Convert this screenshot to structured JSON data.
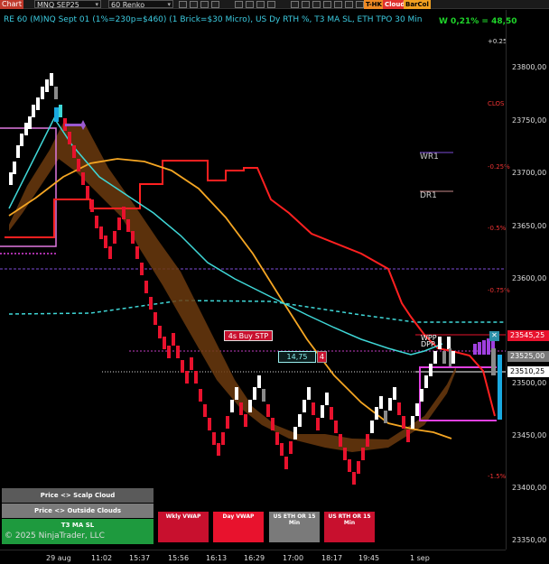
{
  "toolbar": {
    "chart_label": "Chart",
    "instrument": "MNQ SEP25",
    "period": "60 Renko",
    "tags": [
      {
        "label": "T-HK",
        "color": "#f08a24"
      },
      {
        "label": "Cloud",
        "color": "#e0312e"
      },
      {
        "label": "BarCol",
        "color": "#f0a020"
      }
    ]
  },
  "chart": {
    "title": "RE 60 (M)NQ Sept 01 (1%=230p=$460) (1 Brick=$30 Micro), US Dy RTH %, T3 MA SL, ETH TPO 30 Min",
    "pnl": "W 0,21% = 48,50"
  },
  "price_axis": {
    "ticks": [
      "23800,00",
      "23750,00",
      "23700,00",
      "23650,00",
      "23600,00",
      "23500,00",
      "23450,00",
      "23400,00",
      "23350,00"
    ],
    "tags": [
      {
        "label": "23545,25",
        "color": "#e8122d"
      },
      {
        "label": "23525,00",
        "color": "#7a7a7a"
      },
      {
        "label": "23510,25",
        "color": "#ffffff"
      }
    ]
  },
  "time_axis": {
    "ticks": [
      "29 aug",
      "11:02",
      "15:37",
      "15:56",
      "16:13",
      "16:29",
      "17:00",
      "18:17",
      "19:45",
      "1 sep"
    ]
  },
  "labels": {
    "pct_levels": [
      "+0.25",
      "CLOS",
      "-0.25%",
      "-0.5%",
      "-0.75%",
      "-1.5%"
    ],
    "wr1": "WR1",
    "dr1": "DR1",
    "wpp": "WPP",
    "dpp": "DPP",
    "buy_stop": "4s Buy STP",
    "order_price": "14,75",
    "order_qty": "4",
    "close_x": "✕"
  },
  "panel": {
    "rows": [
      "Price <> Scalp Cloud",
      "Price <> Outside Clouds",
      "T3 MA SL"
    ],
    "copyright": "© 2025 NinjaTrader, LLC",
    "buttons": [
      "Wkly VWAP",
      "Day VWAP",
      "US ETH OR 15 Min",
      "US RTH OR 15 Min"
    ]
  },
  "colors": {
    "bull_brick": "#ffffff",
    "bear_brick": "#e8122d",
    "red_line": "#ff2020",
    "orange_curve": "#f5a623",
    "cyan_line": "#3fd7d7",
    "cloud": "#6b3a0e",
    "magenta": "#e040e0"
  }
}
